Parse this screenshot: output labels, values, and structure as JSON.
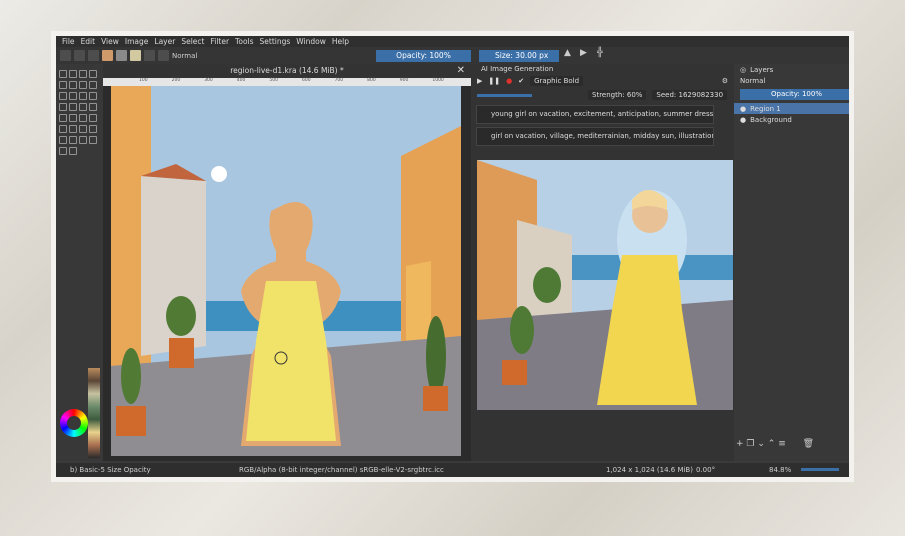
{
  "menu": [
    "File",
    "Edit",
    "View",
    "Image",
    "Layer",
    "Select",
    "Filter",
    "Tools",
    "Settings",
    "Window",
    "Help"
  ],
  "toolbar": {
    "blend_mode": "Normal",
    "opacity": "Opacity: 100%",
    "size": "Size: 30.00 px"
  },
  "document": {
    "title": "region-live-d1.kra (14.6 MiB) *",
    "ruler": [
      "100",
      "200",
      "300",
      "400",
      "500",
      "600",
      "700",
      "800",
      "900",
      "1000"
    ]
  },
  "ai_panel": {
    "title": "AI Image Generation",
    "style": "Graphic Bold",
    "strength": "Strength: 60%",
    "seed": "Seed: 1629082330",
    "prompt_positive": "young girl on vacation, excitement, anticipation, summer dress, safari",
    "prompt_region": "girl on vacation, village, mediterrainian, midday sun, illustration"
  },
  "layers": {
    "title": "Layers",
    "mode": "Normal",
    "opacity": "Opacity: 100%",
    "items": [
      {
        "name": "Region 1",
        "selected": true
      },
      {
        "name": "Background",
        "selected": false
      }
    ]
  },
  "status": {
    "brush": "b) Basic-5 Size Opacity",
    "color_space": "RGB/Alpha (8-bit integer/channel)  sRGB-elle-V2-srgbtrc.icc",
    "dimensions": "1,024 x 1,024 (14.6 MiB)",
    "rotation": "0.00°",
    "zoom": "84.8%"
  },
  "colors": {
    "accent": "#3b6fa8",
    "dress": "#f1e36a",
    "sky": "#a9c6e0"
  }
}
